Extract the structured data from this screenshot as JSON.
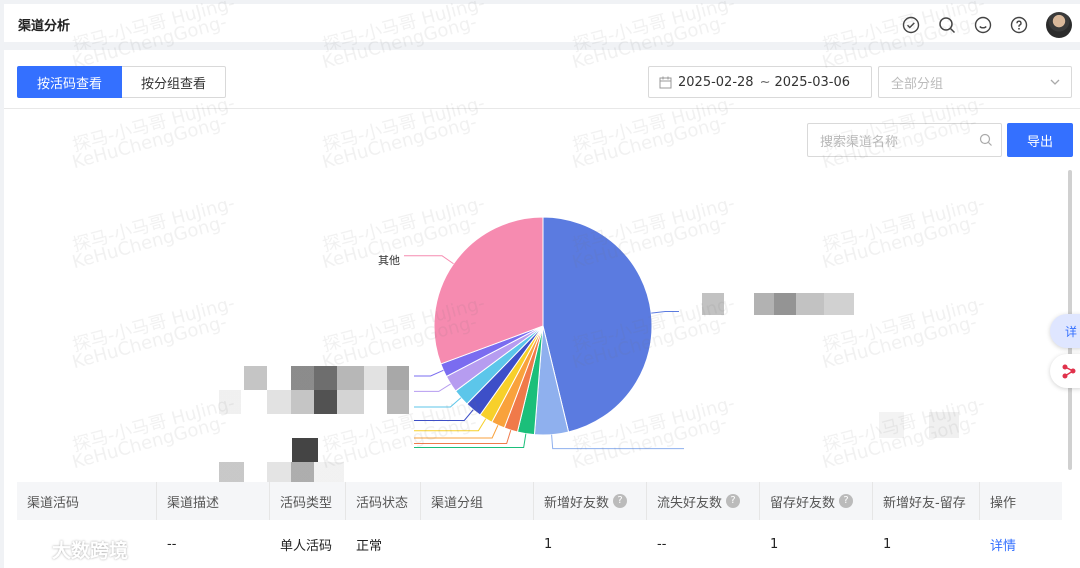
{
  "header": {
    "title": "渠道分析",
    "icons": [
      "check-circle-icon",
      "search-icon",
      "message-icon",
      "help-icon"
    ]
  },
  "toolbar": {
    "tabs": [
      {
        "label": "按活码查看",
        "active": true
      },
      {
        "label": "按分组查看",
        "active": false
      }
    ],
    "date_start": "2025-02-28",
    "date_sep": "~",
    "date_end": "2025-03-06",
    "group_placeholder": "全部分组",
    "search_placeholder": "搜索渠道名称",
    "export_label": "导出"
  },
  "chart_data": {
    "type": "pie",
    "slices": [
      {
        "label": "",
        "value": 46,
        "color": "#5b7be0"
      },
      {
        "label": "",
        "value": 5,
        "color": "#8fb0ee"
      },
      {
        "label": "",
        "value": 2.5,
        "color": "#1bbf7a"
      },
      {
        "label": "",
        "value": 2,
        "color": "#f07a4a"
      },
      {
        "label": "",
        "value": 2,
        "color": "#f9a23c"
      },
      {
        "label": "",
        "value": 2,
        "color": "#f7d02a"
      },
      {
        "label": "",
        "value": 2.5,
        "color": "#3d4fc8"
      },
      {
        "label": "",
        "value": 2.5,
        "color": "#5cc6ea"
      },
      {
        "label": "",
        "value": 2.5,
        "color": "#b69cf0"
      },
      {
        "label": "",
        "value": 2,
        "color": "#7a6cf0"
      },
      {
        "label": "其他",
        "value": 30.5,
        "color": "#f68bb0"
      }
    ]
  },
  "table": {
    "columns": [
      "渠道活码",
      "渠道描述",
      "活码类型",
      "活码状态",
      "渠道分组",
      "新增好友数",
      "流失好友数",
      "留存好友数",
      "新增好友-留存",
      "操作"
    ],
    "help_columns": [
      5,
      6,
      7
    ],
    "rows": [
      [
        "",
        "--",
        "单人活码",
        "正常",
        "",
        "1",
        "--",
        "1",
        "1",
        "详情"
      ]
    ]
  },
  "watermark": {
    "brand": "大数跨境",
    "texts": [
      "探马-小马哥 HuJing-",
      "KeHuChengGong-"
    ]
  },
  "floating": {
    "detail_label": "详"
  }
}
